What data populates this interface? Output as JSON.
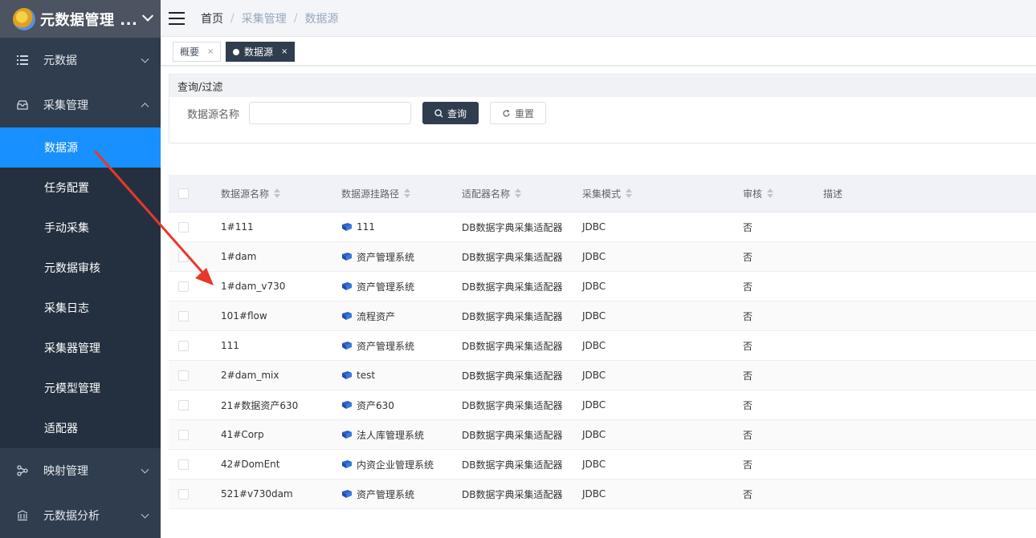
{
  "app": {
    "title": "元数据管理 ..."
  },
  "sidebar": {
    "items": [
      {
        "label": "元数据",
        "icon": "list-icon"
      },
      {
        "label": "采集管理",
        "icon": "inbox-icon"
      },
      {
        "label": "映射管理",
        "icon": "share-icon"
      },
      {
        "label": "元数据分析",
        "icon": "bank-icon"
      }
    ],
    "sub_items": [
      {
        "label": "数据源"
      },
      {
        "label": "任务配置"
      },
      {
        "label": "手动采集"
      },
      {
        "label": "元数据审核"
      },
      {
        "label": "采集日志"
      },
      {
        "label": "采集器管理"
      },
      {
        "label": "元模型管理"
      },
      {
        "label": "适配器"
      }
    ]
  },
  "breadcrumb": [
    "首页",
    "采集管理",
    "数据源"
  ],
  "tabs": [
    {
      "label": "概要",
      "close": "×"
    },
    {
      "label": "数据源",
      "close": "×"
    }
  ],
  "filter": {
    "title": "查询/过滤",
    "field_label": "数据源名称",
    "field_value": "",
    "field_placeholder": "",
    "search_label": "查询",
    "reset_label": "重置"
  },
  "table": {
    "columns": [
      "数据源名称",
      "数据源挂路径",
      "适配器名称",
      "采集模式",
      "审核",
      "描述"
    ],
    "rows": [
      {
        "name": "1#111",
        "path": "111",
        "adapter": "DB数据字典采集适配器",
        "mode": "JDBC",
        "audit": "否",
        "desc": ""
      },
      {
        "name": "1#dam",
        "path": "资产管理系统",
        "adapter": "DB数据字典采集适配器",
        "mode": "JDBC",
        "audit": "否",
        "desc": ""
      },
      {
        "name": "1#dam_v730",
        "path": "资产管理系统",
        "adapter": "DB数据字典采集适配器",
        "mode": "JDBC",
        "audit": "否",
        "desc": ""
      },
      {
        "name": "101#flow",
        "path": "流程资产",
        "adapter": "DB数据字典采集适配器",
        "mode": "JDBC",
        "audit": "否",
        "desc": ""
      },
      {
        "name": "111",
        "path": "资产管理系统",
        "adapter": "DB数据字典采集适配器",
        "mode": "JDBC",
        "audit": "否",
        "desc": ""
      },
      {
        "name": "2#dam_mix",
        "path": "test",
        "adapter": "DB数据字典采集适配器",
        "mode": "JDBC",
        "audit": "否",
        "desc": ""
      },
      {
        "name": "21#数据资产630",
        "path": "资产630",
        "adapter": "DB数据字典采集适配器",
        "mode": "JDBC",
        "audit": "否",
        "desc": ""
      },
      {
        "name": "41#Corp",
        "path": "法人库管理系统",
        "adapter": "DB数据字典采集适配器",
        "mode": "JDBC",
        "audit": "否",
        "desc": ""
      },
      {
        "name": "42#DomEnt",
        "path": "内资企业管理系统",
        "adapter": "DB数据字典采集适配器",
        "mode": "JDBC",
        "audit": "否",
        "desc": ""
      },
      {
        "name": "521#v730dam",
        "path": "资产管理系统",
        "adapter": "DB数据字典采集适配器",
        "mode": "JDBC",
        "audit": "否",
        "desc": ""
      }
    ]
  },
  "colors": {
    "sidebar_bg": "#2f3d4f",
    "active_item": "#1890ff",
    "annotation_arrow": "#e8382b"
  }
}
